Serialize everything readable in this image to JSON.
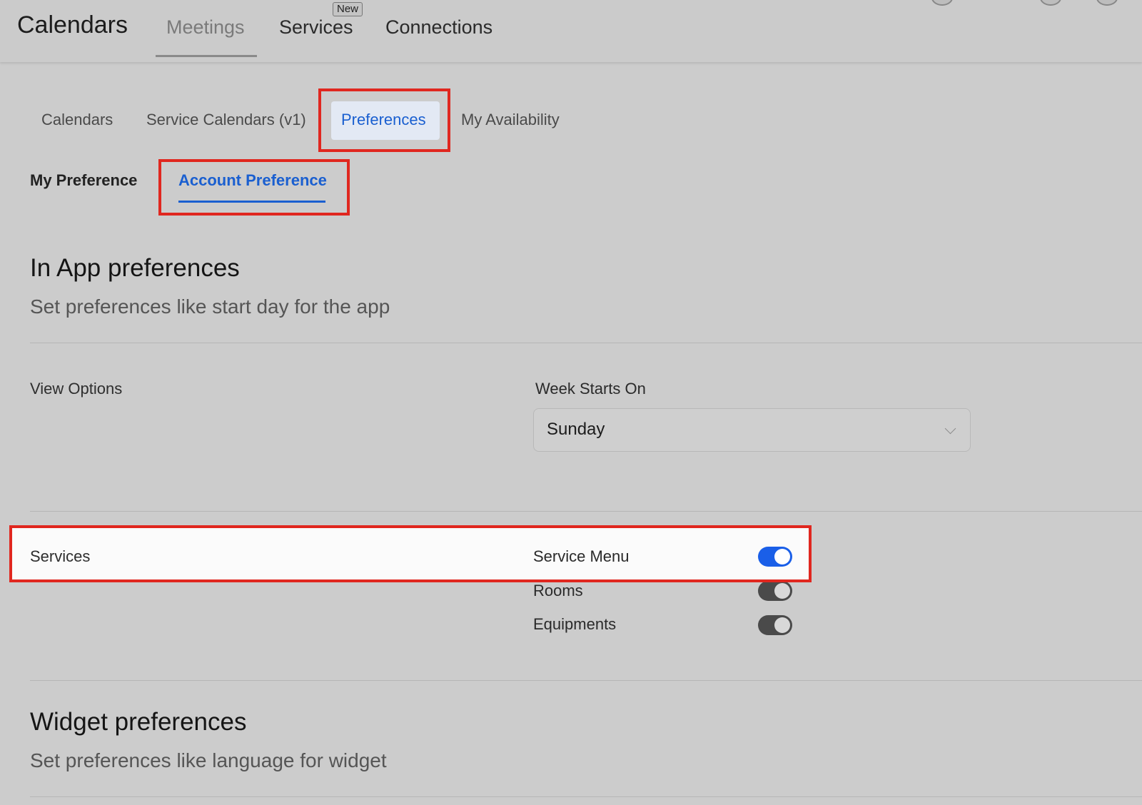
{
  "header": {
    "title": "Calendars",
    "tabs": [
      {
        "label": "Meetings"
      },
      {
        "label": "Services",
        "badge": "New"
      },
      {
        "label": "Connections"
      }
    ]
  },
  "subtabs": [
    {
      "label": "Calendars"
    },
    {
      "label": "Service Calendars (v1)"
    },
    {
      "label": "Preferences"
    },
    {
      "label": "My Availability"
    }
  ],
  "pref_tabs": [
    {
      "label": "My Preference"
    },
    {
      "label": "Account Preference"
    }
  ],
  "in_app": {
    "title": "In App preferences",
    "subtitle": "Set preferences like start day for the app",
    "view_options": {
      "label": "View Options",
      "week_starts_label": "Week Starts On",
      "week_starts_value": "Sunday"
    },
    "services": {
      "label": "Services",
      "toggles": [
        {
          "label": "Service Menu",
          "on": true
        },
        {
          "label": "Rooms",
          "on": true
        },
        {
          "label": "Equipments",
          "on": true
        }
      ]
    }
  },
  "widget": {
    "title": "Widget preferences",
    "subtitle": "Set preferences like language for widget"
  },
  "colors": {
    "accent": "#1a5fd0",
    "highlight": "#e0271f",
    "toggle_on": "#1a5fe8"
  }
}
